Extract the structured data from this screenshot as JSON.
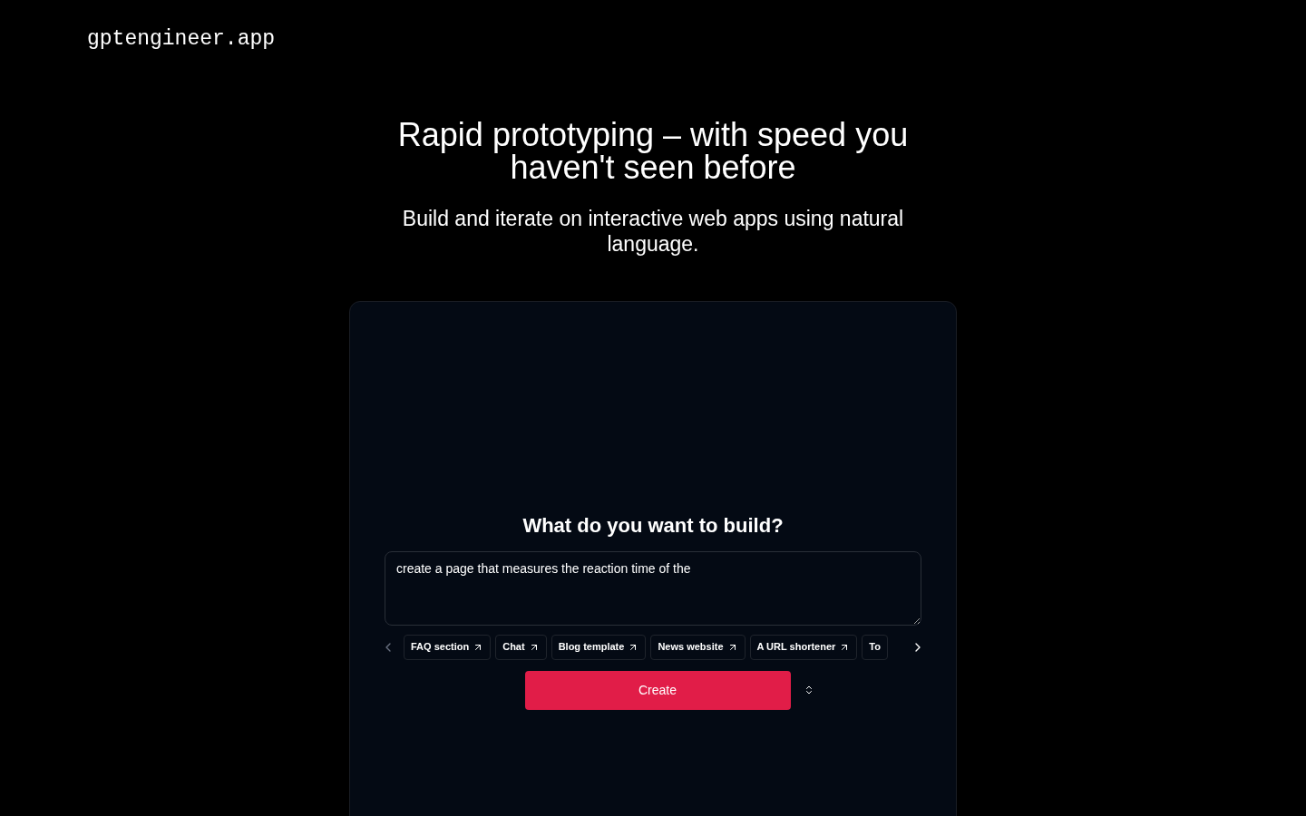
{
  "logo": "gptengineer.app",
  "headline": "Rapid prototyping – with speed you haven't seen before",
  "subtitle": "Build and iterate on interactive web apps using natural language.",
  "prompt_card": {
    "heading": "What do you want to build?",
    "input": {
      "value": "create a page that measures the reaction time of the"
    },
    "suggestions": [
      "FAQ section",
      "Chat",
      "Blog template",
      "News website",
      "A URL shortener",
      "To"
    ],
    "create_button": "Create"
  }
}
